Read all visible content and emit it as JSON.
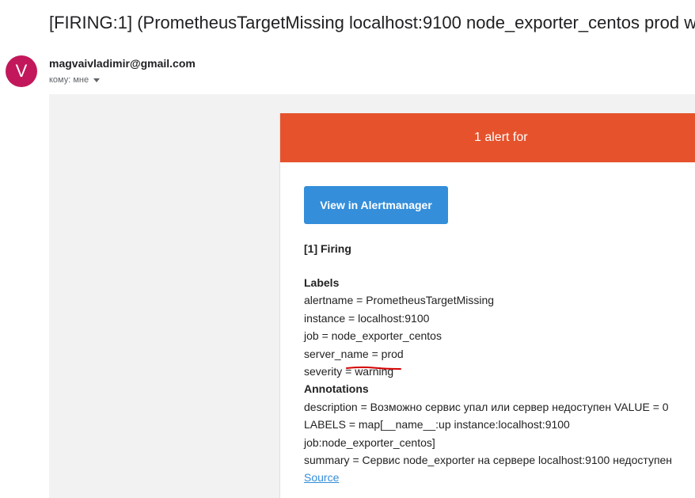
{
  "email": {
    "subject": "[FIRING:1] (PrometheusTargetMissing localhost:9100 node_exporter_centos prod w",
    "avatar_letter": "V",
    "avatar_color": "#c2185b",
    "sender": "magvaivladimir@gmail.com",
    "recipient": "кому: мне"
  },
  "card": {
    "header_text": "1 alert for",
    "header_color": "#e6522c",
    "button_label": "View in Alertmanager",
    "button_color": "#348eda",
    "firing_title": "[1] Firing",
    "labels_heading": "Labels",
    "labels": [
      "alertname = PrometheusTargetMissing",
      "instance = localhost:9100",
      "job = node_exporter_centos",
      "server_name = prod",
      "severity = warning"
    ],
    "annotations_heading": "Annotations",
    "annotations": [
      "description = Возможно сервис упал или сервер недоступен VALUE = 0",
      "LABELS = map[__name__:up instance:localhost:9100",
      "job:node_exporter_centos]",
      "summary = Сервис node_exporter на сервере localhost:9100 недоступен"
    ],
    "source_link": "Source",
    "underline_color": "#d50000"
  }
}
